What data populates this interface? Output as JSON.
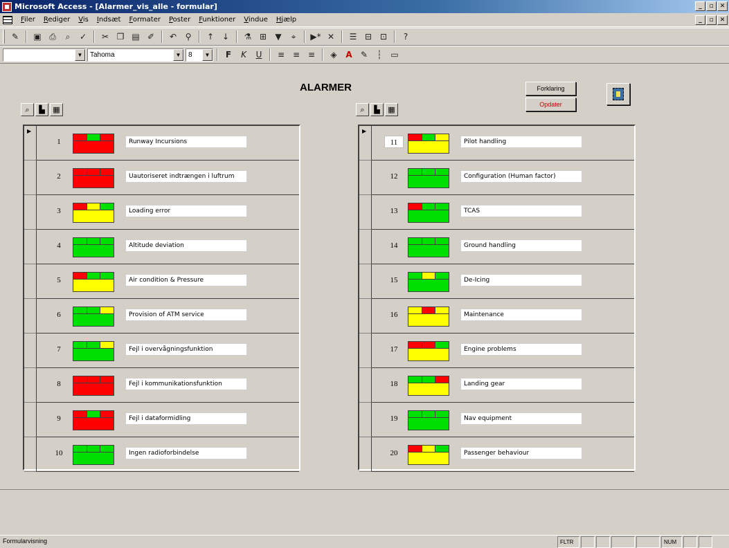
{
  "window": {
    "title": "Microsoft Access - [Alarmer_vis_alle - formular]"
  },
  "menu": [
    "Filer",
    "Rediger",
    "Vis",
    "Indsæt",
    "Formater",
    "Poster",
    "Funktioner",
    "Vindue",
    "Hjælp"
  ],
  "format_toolbar": {
    "object_combo": "",
    "font": "Tahoma",
    "font_size": "8"
  },
  "form": {
    "title": "ALARMER",
    "buttons": {
      "forklaring": "Forklaring",
      "opdater": "Opdater"
    }
  },
  "colors": {
    "red": "#ff0000",
    "green": "#00e000",
    "yellow": "#ffff00"
  },
  "left_alarms": [
    {
      "num": "1",
      "label": "Runway Incursions",
      "top": [
        "red",
        "green",
        "red"
      ],
      "main": "red"
    },
    {
      "num": "2",
      "label": "Uautoriseret indtrængen i luftrum",
      "top": [
        "red",
        "red",
        "red"
      ],
      "main": "red"
    },
    {
      "num": "3",
      "label": "Loading error",
      "top": [
        "red",
        "yellow",
        "green"
      ],
      "main": "yellow"
    },
    {
      "num": "4",
      "label": "Altitude deviation",
      "top": [
        "green",
        "green",
        "green"
      ],
      "main": "green"
    },
    {
      "num": "5",
      "label": "Air condition & Pressure",
      "top": [
        "red",
        "green",
        "green"
      ],
      "main": "yellow"
    },
    {
      "num": "6",
      "label": "Provision of ATM service",
      "top": [
        "green",
        "green",
        "yellow"
      ],
      "main": "green"
    },
    {
      "num": "7",
      "label": "Fejl i overvågningsfunktion",
      "top": [
        "green",
        "green",
        "yellow"
      ],
      "main": "green"
    },
    {
      "num": "8",
      "label": "Fejl i kommunikationsfunktion",
      "top": [
        "red",
        "red",
        "red"
      ],
      "main": "red"
    },
    {
      "num": "9",
      "label": "Fejl i dataformidling",
      "top": [
        "red",
        "green",
        "red"
      ],
      "main": "red"
    },
    {
      "num": "10",
      "label": "Ingen radioforbindelse",
      "top": [
        "green",
        "green",
        "green"
      ],
      "main": "green"
    }
  ],
  "right_alarms": [
    {
      "num": "11",
      "label": "Pilot handling",
      "top": [
        "red",
        "green",
        "yellow"
      ],
      "main": "yellow"
    },
    {
      "num": "12",
      "label": "Configuration (Human factor)",
      "top": [
        "green",
        "green",
        "green"
      ],
      "main": "green"
    },
    {
      "num": "13",
      "label": "TCAS",
      "top": [
        "red",
        "green",
        "green"
      ],
      "main": "green"
    },
    {
      "num": "14",
      "label": "Ground handling",
      "top": [
        "green",
        "green",
        "green"
      ],
      "main": "green"
    },
    {
      "num": "15",
      "label": "De-Icing",
      "top": [
        "green",
        "yellow",
        "green"
      ],
      "main": "green"
    },
    {
      "num": "16",
      "label": "Maintenance",
      "top": [
        "yellow",
        "red",
        "yellow"
      ],
      "main": "yellow"
    },
    {
      "num": "17",
      "label": "Engine problems",
      "top": [
        "red",
        "red",
        "green"
      ],
      "main": "yellow"
    },
    {
      "num": "18",
      "label": "Landing gear",
      "top": [
        "green",
        "green",
        "red"
      ],
      "main": "yellow"
    },
    {
      "num": "19",
      "label": "Nav equipment",
      "top": [
        "green",
        "green",
        "green"
      ],
      "main": "green"
    },
    {
      "num": "20",
      "label": "Passenger behaviour",
      "top": [
        "red",
        "yellow",
        "green"
      ],
      "main": "yellow"
    }
  ],
  "status": {
    "text": "Formularvisning",
    "cells": [
      "FLTR",
      "",
      "",
      "",
      "",
      "NUM",
      "",
      ""
    ]
  }
}
